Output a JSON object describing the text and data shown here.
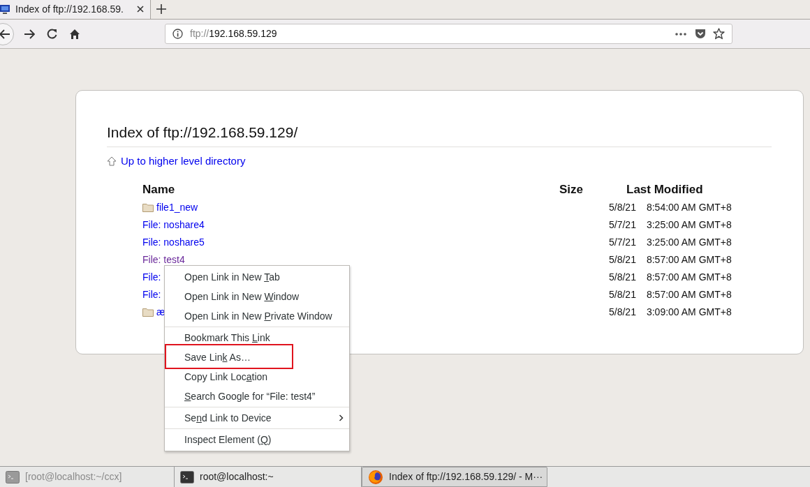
{
  "browser_tab": {
    "title": "Index of ftp://192.168.59.",
    "selected": true
  },
  "address_bar": {
    "scheme": "ftp://",
    "host": "192.168.59.129"
  },
  "page": {
    "heading": "Index of ftp://192.168.59.129/",
    "up_link": "Up to higher level directory",
    "columns": [
      "Name",
      "Size",
      "Last Modified"
    ],
    "rows": [
      {
        "kind": "folder",
        "name": "file1_new",
        "visited": false,
        "date": "5/8/21",
        "time": "8:54:00 AM GMT+8"
      },
      {
        "kind": "file",
        "name": "File: noshare4",
        "visited": false,
        "date": "5/7/21",
        "time": "3:25:00 AM GMT+8"
      },
      {
        "kind": "file",
        "name": "File: noshare5",
        "visited": false,
        "date": "5/7/21",
        "time": "3:25:00 AM GMT+8"
      },
      {
        "kind": "file",
        "name": "File: test4",
        "visited": true,
        "date": "5/8/21",
        "time": "8:57:00 AM GMT+8"
      },
      {
        "kind": "file",
        "name": "File:",
        "visited": false,
        "date": "5/8/21",
        "time": "8:57:00 AM GMT+8"
      },
      {
        "kind": "file",
        "name": "File:",
        "visited": false,
        "date": "5/8/21",
        "time": "8:57:00 AM GMT+8"
      },
      {
        "kind": "folder",
        "name": "æ",
        "visited": false,
        "date": "5/8/21",
        "time": "3:09:00 AM GMT+8"
      }
    ]
  },
  "context_menu": [
    {
      "kind": "item",
      "before": "Open Link in New ",
      "key": "T",
      "after": "ab",
      "highlighted": false
    },
    {
      "kind": "item",
      "before": "Open Link in New ",
      "key": "W",
      "after": "indow",
      "highlighted": false
    },
    {
      "kind": "item",
      "before": "Open Link in New ",
      "key": "P",
      "after": "rivate Window",
      "highlighted": false
    },
    {
      "kind": "separator"
    },
    {
      "kind": "item",
      "before": "Bookmark This ",
      "key": "L",
      "after": "ink",
      "highlighted": false
    },
    {
      "kind": "item",
      "before": "Save Lin",
      "key": "k",
      "after": " As…",
      "highlighted": true
    },
    {
      "kind": "item",
      "before": "Copy Link Loc",
      "key": "a",
      "after": "tion",
      "highlighted": false
    },
    {
      "kind": "item",
      "key": "S",
      "after": "earch Google for “File: test4”",
      "highlighted": false
    },
    {
      "kind": "separator"
    },
    {
      "kind": "submenu",
      "before": "Se",
      "key": "n",
      "after": "d Link to Device",
      "highlighted": false
    },
    {
      "kind": "separator"
    },
    {
      "kind": "item",
      "before": "Inspect Element (",
      "key": "Q",
      "after": ")",
      "highlighted": false
    }
  ],
  "taskbar": [
    {
      "kind": "terminal",
      "label": "[root@localhost:~/ccx]",
      "selected": false,
      "dimmed": true
    },
    {
      "kind": "terminal",
      "label": "root@localhost:~",
      "selected": false,
      "dimmed": false
    },
    {
      "kind": "browser",
      "label": "Index of ftp://192.168.59.129/ - M···",
      "selected": true,
      "dimmed": false
    }
  ]
}
